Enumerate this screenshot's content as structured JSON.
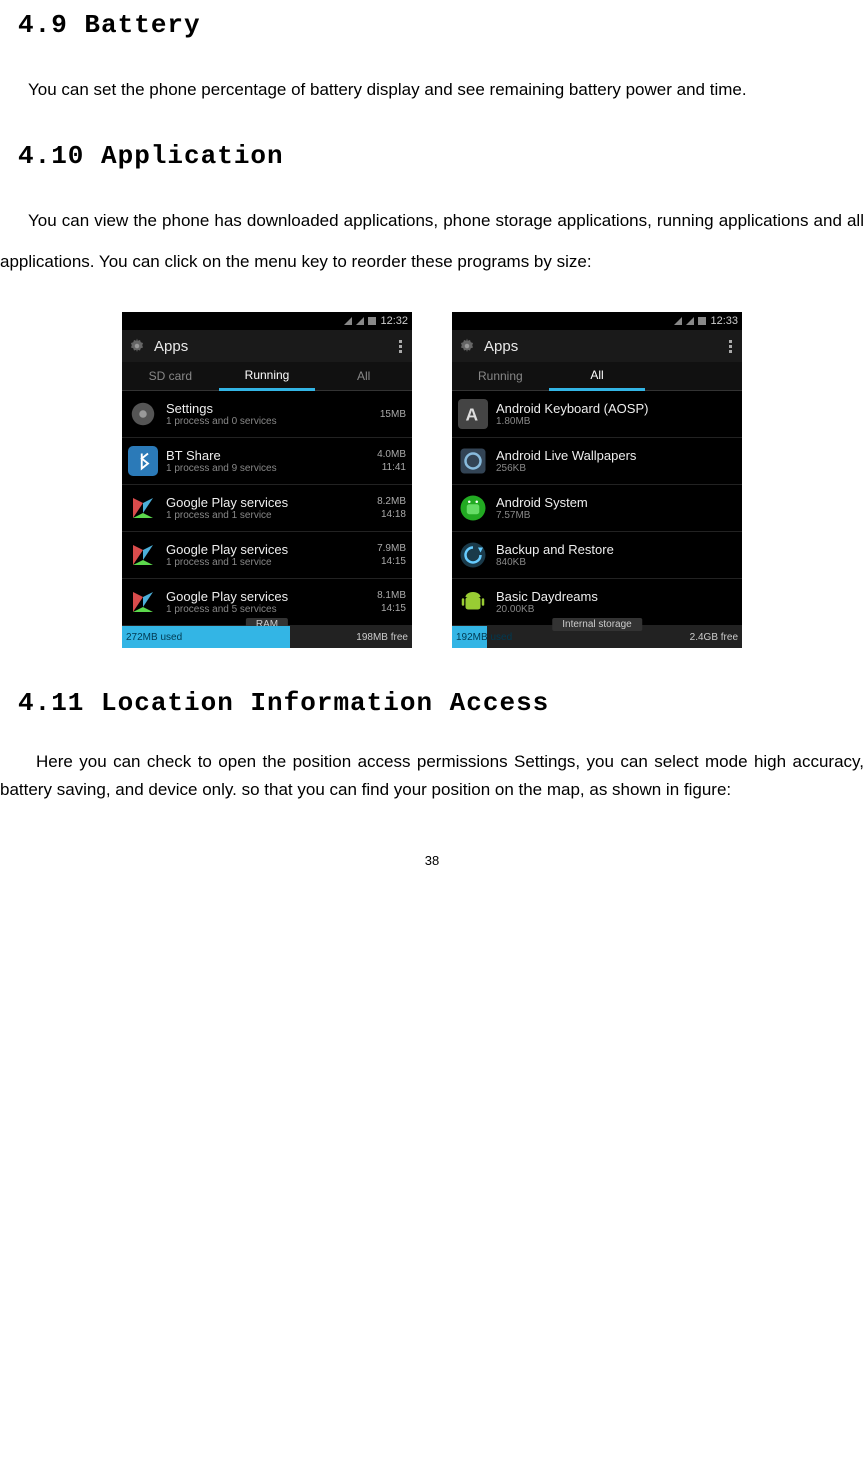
{
  "headings": {
    "h49": "4.9  Battery",
    "h410": "4.10 Application",
    "h411": "4.11 Location Information Access"
  },
  "paragraphs": {
    "battery": "You can set the phone percentage of battery display and see remaining battery power and time.",
    "application": "You can view the phone has downloaded applications, phone storage applications, running applications and all applications. You can click on the menu key to reorder these programs by size:",
    "location": "Here you can check to open the position access permissions Settings, you can select mode high accuracy, battery saving, and device only. so that you can find your position on the map, as shown in figure:"
  },
  "screens": {
    "left": {
      "time": "12:32",
      "header": "Apps",
      "tabs": {
        "sd": "SD card",
        "running": "Running",
        "all": "All"
      },
      "items": [
        {
          "title": "Settings",
          "sub": "1 process and 0 services",
          "right1": "15MB",
          "right2": ""
        },
        {
          "title": "BT Share",
          "sub": "1 process and 9 services",
          "right1": "4.0MB",
          "right2": "11:41"
        },
        {
          "title": "Google Play services",
          "sub": "1 process and 1 service",
          "right1": "8.2MB",
          "right2": "14:18"
        },
        {
          "title": "Google Play services",
          "sub": "1 process and 1 service",
          "right1": "7.9MB",
          "right2": "14:15"
        },
        {
          "title": "Google Play services",
          "sub": "1 process and 5 services",
          "right1": "8.1MB",
          "right2": "14:15"
        }
      ],
      "footer": {
        "label": "RAM",
        "left": "272MB used",
        "right": "198MB free",
        "fillPercent": "58%"
      }
    },
    "right": {
      "time": "12:33",
      "header": "Apps",
      "tabs": {
        "running": "Running",
        "all": "All"
      },
      "items": [
        {
          "title": "Android Keyboard (AOSP)",
          "sub": "1.80MB"
        },
        {
          "title": "Android Live Wallpapers",
          "sub": "256KB"
        },
        {
          "title": "Android System",
          "sub": "7.57MB"
        },
        {
          "title": "Backup and Restore",
          "sub": "840KB"
        },
        {
          "title": "Basic Daydreams",
          "sub": "20.00KB"
        }
      ],
      "footer": {
        "label": "Internal storage",
        "left": "192MB used",
        "right": "2.4GB free",
        "fillPercent": "12%"
      }
    }
  },
  "pageNumber": "38"
}
